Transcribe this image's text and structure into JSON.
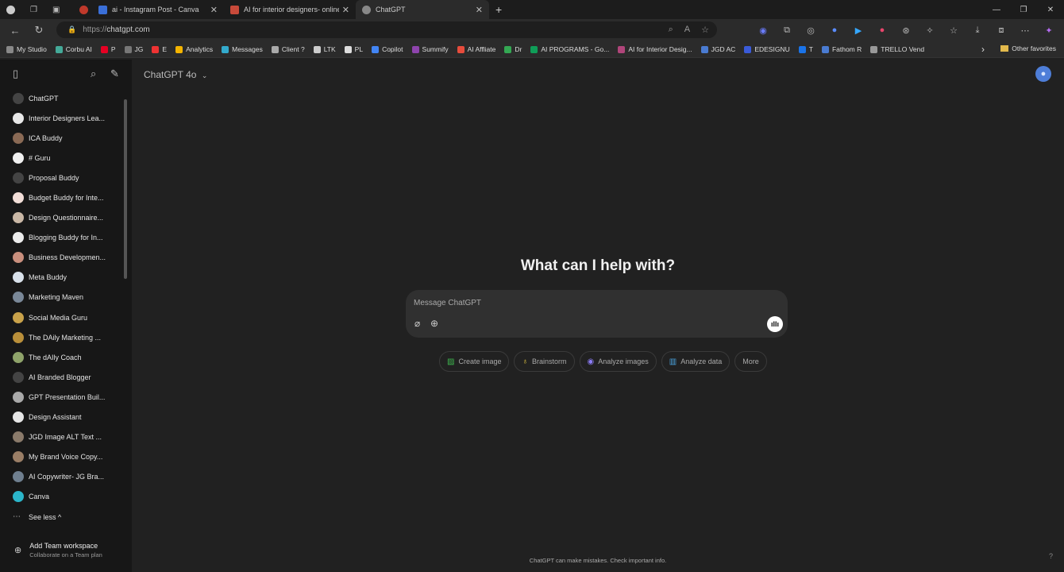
{
  "browser": {
    "tabs": [
      {
        "label": "",
        "active": false
      },
      {
        "label": "ai - Instagram Post - Canva",
        "active": false
      },
      {
        "label": "AI for interior designers- online e",
        "active": false
      },
      {
        "label": "ChatGPT",
        "active": true
      }
    ],
    "new_tab": "+",
    "url_proto": "https://",
    "url_host": "chatgpt.com",
    "bookmarks": [
      "My Studio",
      "Corbu AI",
      "P",
      "JG",
      "E",
      "Analytics",
      "Messages",
      "Client ?",
      "LTK",
      "PL",
      "Copilot",
      "Summify",
      "AI Affliate",
      "Dr",
      "AI PROGRAMS - Go...",
      "AI for Interior Desig...",
      "JGD AC",
      "EDESIGNU",
      "T",
      "Fathom R",
      "TRELLO Vend"
    ],
    "other_favorites": "Other favorites"
  },
  "sidebar": {
    "items": [
      {
        "label": "ChatGPT",
        "color": "#444"
      },
      {
        "label": "Interior Designers Lea...",
        "color": "#e8e8e8"
      },
      {
        "label": "ICA Buddy",
        "color": "#8a6a55"
      },
      {
        "label": "# Guru",
        "color": "#f0f0f0"
      },
      {
        "label": "Proposal Buddy",
        "color": "#444"
      },
      {
        "label": "Budget Buddy for Inte...",
        "color": "#f2ded8"
      },
      {
        "label": "Design Questionnaire...",
        "color": "#c9b7a5"
      },
      {
        "label": "Blogging Buddy for In...",
        "color": "#ececec"
      },
      {
        "label": "Business Developmen...",
        "color": "#c98f7d"
      },
      {
        "label": "Meta Buddy",
        "color": "#d9e1ea"
      },
      {
        "label": "Marketing Maven",
        "color": "#7a8898"
      },
      {
        "label": "Social Media Guru",
        "color": "#c9a24a"
      },
      {
        "label": "The DAily Marketing ...",
        "color": "#b98f3a"
      },
      {
        "label": "The dAIly Coach",
        "color": "#8fa36a"
      },
      {
        "label": "AI Branded Blogger",
        "color": "#444"
      },
      {
        "label": "GPT Presentation Buil...",
        "color": "#a9a9a9"
      },
      {
        "label": "Design Assistant",
        "color": "#e6e6e6"
      },
      {
        "label": "JGD Image ALT Text ...",
        "color": "#8a7a6a"
      },
      {
        "label": "My Brand Voice Copy...",
        "color": "#9a7e66"
      },
      {
        "label": "AI Copywriter- JG Bra...",
        "color": "#6f7f8f"
      },
      {
        "label": "Canva",
        "color": "#2bb5c9"
      },
      {
        "label": "See less ^",
        "color": "transparent"
      }
    ],
    "team_title": "Add Team workspace",
    "team_subtitle": "Collaborate on a Team plan"
  },
  "main": {
    "model_label": "ChatGPT 4o",
    "headline": "What can I help with?",
    "composer_placeholder": "Message ChatGPT",
    "chips": [
      {
        "label": "Create image",
        "icon": "image-icon",
        "color": "#3fb950"
      },
      {
        "label": "Brainstorm",
        "icon": "lightbulb-icon",
        "color": "#e2c541"
      },
      {
        "label": "Analyze images",
        "icon": "eye-icon",
        "color": "#8b7cf6"
      },
      {
        "label": "Analyze data",
        "icon": "chart-icon",
        "color": "#4aa3df"
      },
      {
        "label": "More",
        "icon": "",
        "color": "#aaa"
      }
    ],
    "footer": "ChatGPT can make mistakes. Check important info.",
    "help": "?"
  }
}
